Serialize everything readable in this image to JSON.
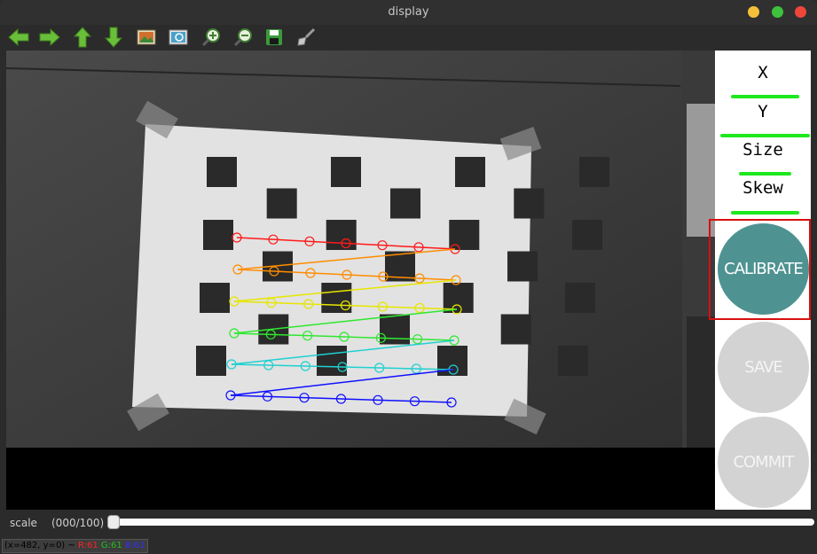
{
  "window": {
    "title": "display"
  },
  "panel": {
    "x_label": "X",
    "y_label": "Y",
    "size_label": "Size",
    "skew_label": "Skew",
    "x_progress": 0.74,
    "y_progress": 0.97,
    "size_progress": 0.57,
    "skew_progress": 0.74,
    "calibrate_label": "CALIBRATE",
    "save_label": "SAVE",
    "commit_label": "COMMIT",
    "calibrate_color": "#4f9292",
    "disabled_color": "#d3d3d3",
    "bar_color": "#1ee81e"
  },
  "trackbar": {
    "name": "scale",
    "value_text": "(000/100)",
    "value": 0
  },
  "status": {
    "coords": "(x=482, y=0) ~",
    "r": "R:61",
    "g": "G:61",
    "b": "B:61"
  },
  "toolbar_icons": [
    "left-arrow-icon",
    "right-arrow-icon",
    "up-arrow-icon",
    "down-arrow-icon",
    "image-icon",
    "zoom-fit-icon",
    "zoom-in-icon",
    "zoom-out-icon",
    "save-icon",
    "brush-icon"
  ],
  "corner_row_colors": [
    "#ff1a1a",
    "#ff8c00",
    "#e6e600",
    "#2ee82e",
    "#20d0d0",
    "#1010ff"
  ]
}
